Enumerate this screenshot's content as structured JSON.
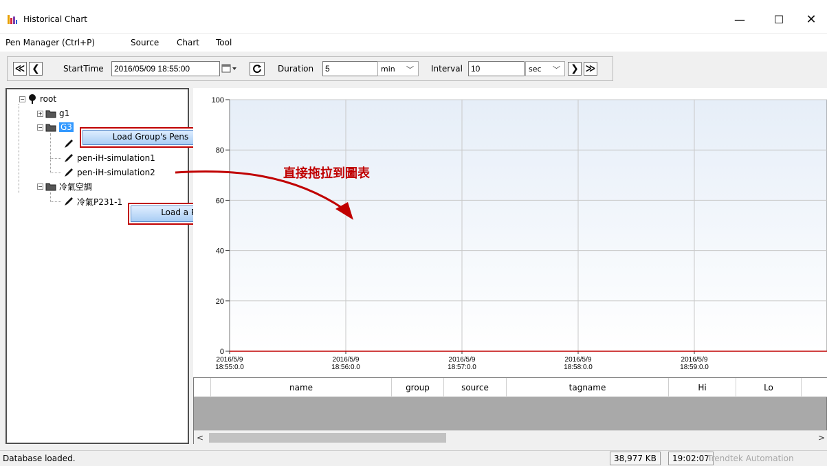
{
  "window": {
    "title": "Historical Chart",
    "minimize": "—",
    "maximize": "☐",
    "close": "✕"
  },
  "menu": [
    "Pen Manager (Ctrl+P)",
    "Source",
    "Chart",
    "Tool"
  ],
  "toolbar": {
    "first_btn": "≪",
    "prev_btn": "❮",
    "starttime_label": "StartTime",
    "starttime_value": "2016/05/09 18:55:00",
    "calendar_icon": "calendar-icon",
    "refresh_icon": "refresh-icon",
    "duration_label": "Duration",
    "duration_value": "5",
    "duration_unit": "min",
    "interval_label": "Interval",
    "interval_value": "10",
    "interval_unit": "sec",
    "next_btn": "❯",
    "last_btn": "≫"
  },
  "tree": {
    "root": "root",
    "g1": "g1",
    "g3": "G3",
    "pen1": "pen-iH-simulation1",
    "pen2": "pen-iH-simulation2",
    "aircon_group": "冷氣空調",
    "aircon_pen": "冷氣P231-1"
  },
  "context": {
    "load_group": "Load Group's Pens",
    "load_pen": "Load a Pen"
  },
  "annotation": "直接拖拉到圖表",
  "chart_data": {
    "type": "line",
    "title": "",
    "xlabel": "",
    "ylabel": "",
    "ylim": [
      0,
      100
    ],
    "yticks": [
      "0",
      "20",
      "40",
      "60",
      "80",
      "100"
    ],
    "xticks": [
      {
        "date": "2016/5/9",
        "time": "18:55:0.0"
      },
      {
        "date": "2016/5/9",
        "time": "18:56:0.0"
      },
      {
        "date": "2016/5/9",
        "time": "18:57:0.0"
      },
      {
        "date": "2016/5/9",
        "time": "18:58:0.0"
      },
      {
        "date": "2016/5/9",
        "time": "18:59:0.0"
      }
    ],
    "series": [],
    "grid": true
  },
  "grid": {
    "columns": [
      "name",
      "group",
      "source",
      "tagname",
      "Hi",
      "Lo"
    ]
  },
  "status": {
    "text": "Database loaded.",
    "memory": "38,977 KB",
    "clock": "19:02:07",
    "company": "Trendtek Automation"
  },
  "colors": {
    "accent": "#c00000",
    "selection": "#3399ff",
    "plot_top": "#e6eef8",
    "plot_bottom": "#ffffff"
  }
}
